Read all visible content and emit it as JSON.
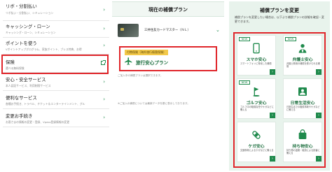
{
  "left_menu": {
    "items": [
      {
        "title": "リボ・分割払い",
        "sub": "リボ払い・分割払い、シミュレーション",
        "icon": "chevron-right-icon"
      },
      {
        "title": "キャッシング・ローン",
        "sub": "キャッシング・ローン、シミュレーション",
        "icon": "chevron-right-icon"
      },
      {
        "title": "ポイントを使う",
        "sub": "Vポイントアップグログラム、家族ポイント、ブレス特典、お得",
        "icon": "chevron-right-icon"
      },
      {
        "title": "保険",
        "sub": "選べる無料保険",
        "icon": "external-link-icon"
      },
      {
        "title": "安心・安全サービス",
        "sub": "本人認証サービス、利用制限サービス",
        "icon": "chevron-right-icon"
      },
      {
        "title": "便利なサービス",
        "sub": "各種お手続き、トラベル、チケット＆エンターテインメント、グル",
        "icon": "chevron-right-icon"
      },
      {
        "title": "変更お手続き",
        "sub": "お客さまの情報の変更・登録、Vpass登録情報の変更",
        "icon": "chevron-right-icon"
      }
    ]
  },
  "center": {
    "header": "現在の補償プラン",
    "card_name": "三井住友カードマスター（ＮＬ）",
    "plan_tag": "付帯保険（海外旅行傷害保険）",
    "plan_name": "旅行安心プラン",
    "note1": "ご加入中の補償プランは選択できます。",
    "note2": "※ご加入の補償については最新データを基に表示しております。"
  },
  "right": {
    "title": "補償プランを変更",
    "desc": "補償プランを変更したい場合は、以下より補償プランの詳細を確認・変更できます。",
    "new_label": "NEW",
    "tiles": [
      {
        "name": "スマホ安心",
        "desc": "スマートフォンに特化した補償",
        "icon": "smartphone-icon",
        "is_new": true
      },
      {
        "name": "弁護士安心",
        "desc": "弁護士費用の補償を受けられる補償",
        "icon": "lawyer-icon",
        "is_new": true
      },
      {
        "name": "ゴルフ安心",
        "desc": "ゴルフ中の賠償責任やケガなどに備える",
        "icon": "golf-icon",
        "is_new": true
      },
      {
        "name": "日常生活安心",
        "desc": "日常生活での賠償事故やケガなどに備える",
        "icon": "daily-life-icon",
        "is_new": false
      },
      {
        "name": "ケガ安心",
        "desc": "交通事故によるケガなどに備える",
        "icon": "bandage-icon",
        "is_new": false
      },
      {
        "name": "持ち物安心",
        "desc": "持ち物の盗難・破損による損害に備える",
        "icon": "bag-icon",
        "is_new": false
      }
    ]
  },
  "colors": {
    "accent_green": "#1f8a4c",
    "highlight_red": "#e0262b",
    "tag_yellow": "#f3c94a",
    "right_bg": "#e8f3ec"
  }
}
